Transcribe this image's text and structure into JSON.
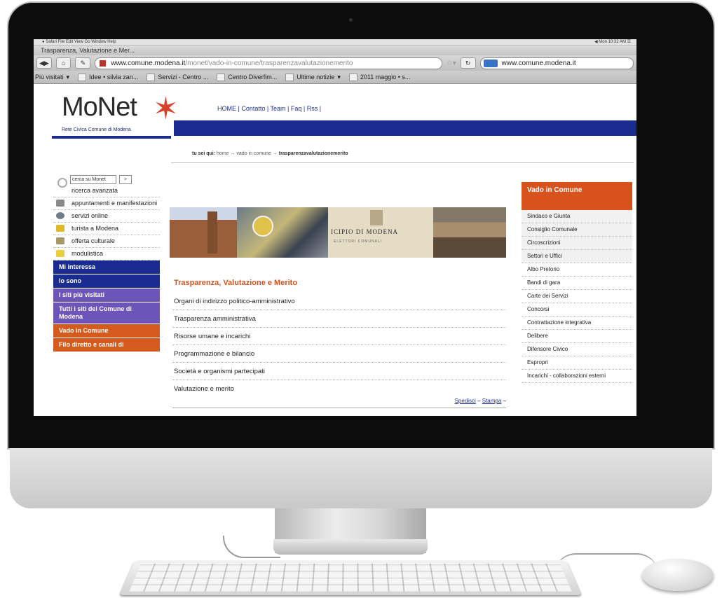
{
  "browser": {
    "menubar": "● Safari  File  Edit  View  Go  Window  Help",
    "menubar_right": "◀  Mon 10:32 AM  ☰",
    "title": "Trasparenza, Valutazione e Mer...",
    "url_host": "www.comune.modena.it",
    "url_path": "/monet/vado-in-comune/trasparenzavalutazionemerito",
    "search": "www.comune.modena.it",
    "bookmarks": [
      "Più visitati",
      "Idee • silvia zan...",
      "Servizi - Centro ...",
      "Centro Diverfim...",
      "Ultime notizie",
      "2011 maggio • s..."
    ]
  },
  "site": {
    "logo": "MoNet",
    "logo_sub": "Rete Civica Comune di Modena",
    "toplinks": "HOME | Contatto | Team | Faq | Rss |",
    "breadcrumb_prefix": "tu sei qui:",
    "breadcrumb": "home → vado in comune →",
    "breadcrumb_current": "trasparenzavalutazionemerito"
  },
  "left": {
    "search_placeholder": "cerca su Monet",
    "search_btn": ">",
    "items": [
      "ricerca avanzata",
      "appuntamenti e manifestazioni",
      "servizi online",
      "turista a Modena",
      "offerta culturale",
      "modulistica"
    ],
    "buttons": [
      "Mi interessa",
      "Io sono",
      "I siti più visitati",
      "Tutti i siti del Comune di Modena",
      "Vado in Comune",
      "Filo diretto e canali di"
    ]
  },
  "banner": {
    "title": "ICIPIO DI MODENA",
    "subtitle": "ELETTORI COMUNALI"
  },
  "main": {
    "title": "Trasparenza, Valutazione e Merito",
    "links": [
      "Organi di indirizzo politico-amministrativo",
      "Trasparenza amministrativa",
      "Risorse umane e incarichi",
      "Programmazione e bilancio",
      "Società e organismi partecipati",
      "Valutazione e merito"
    ],
    "send": "Spedisci",
    "print": "Stampa"
  },
  "right": {
    "header": "Vado in Comune",
    "items": [
      "Sindaco e Giunta",
      "Consiglio Comunale",
      "Circoscrizioni",
      "Settori e Uffici",
      "Albo Pretorio",
      "Bandi di gara",
      "Carte dei Servizi",
      "Concorsi",
      "Contrattazione integrativa",
      "Delibere",
      "Difensore Civico",
      "Espropri",
      "Incarichi - collaborazioni esterni"
    ]
  },
  "colors": {
    "accent_orange": "#d8521e",
    "nav_blue": "#1a2c8f",
    "purple": "#6d55b8"
  }
}
